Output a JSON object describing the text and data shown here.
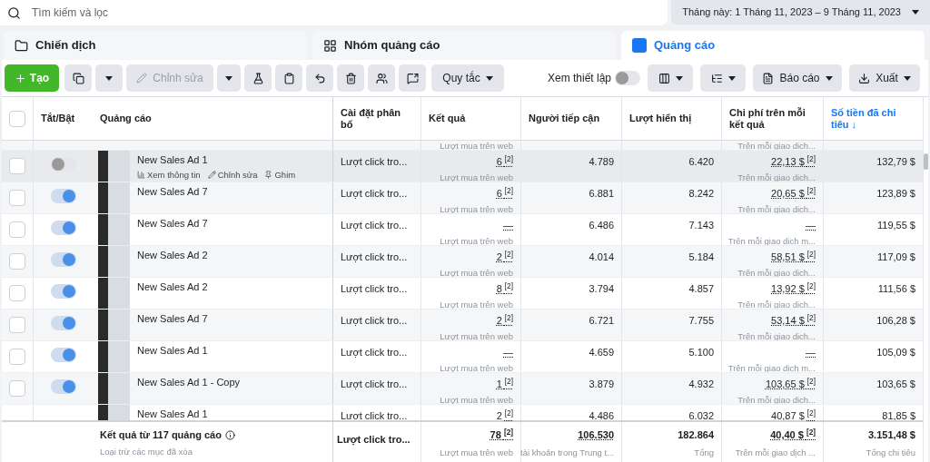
{
  "search": {
    "placeholder": "Tìm kiếm và lọc"
  },
  "date_range": "Tháng này: 1 Tháng 11, 2023 – 9 Tháng 11, 2023",
  "tabs": [
    {
      "label": "Chiến dịch",
      "selected": false,
      "kind": "folder"
    },
    {
      "label": "Nhóm quảng cáo",
      "selected": false,
      "kind": "grid"
    },
    {
      "label": "Quảng cáo",
      "selected": true,
      "kind": "ad"
    }
  ],
  "toolbar": {
    "create": "Tạo",
    "edit": {
      "label": "Chỉnh sửa",
      "disabled": true
    },
    "rules": "Quy tắc",
    "view_settings": {
      "label": "Xem thiết lập",
      "on": false
    },
    "report": "Báo cáo",
    "export": "Xuất"
  },
  "table": {
    "header_checkbox": {
      "checked": false
    },
    "columns": [
      {
        "label": "Tắt/Bật",
        "sorted": false
      },
      {
        "label": "Quảng cáo",
        "sorted": false
      },
      {
        "label": "Cài đặt phân bổ",
        "sorted": false
      },
      {
        "label": "Kết quả",
        "sorted": false
      },
      {
        "label": "Người tiếp cận",
        "sorted": false
      },
      {
        "label": "Lượt hiển thị",
        "sorted": false
      },
      {
        "label": "Chi phí trên mỗi kết quả",
        "sorted": false
      },
      {
        "label": "Số tiền đã chi tiêu ↓",
        "sorted": true
      }
    ],
    "rows": [
      {
        "kind": "cut_top",
        "result_sub": "Lượt mua trên web",
        "cost_sub": "Trên mỗi giao dịch..."
      },
      {
        "kind": "full",
        "checked": false,
        "on": false,
        "highlighted": true,
        "name": "New Sales Ad 1",
        "actions": [
          "Xem thông tin",
          "Chỉnh sửa",
          "Ghim"
        ],
        "attribution": "Lượt click tro...",
        "result": "6 $^{[2]}$",
        "result_sub": "Lượt mua trên web",
        "reach": "4.789",
        "impressions": "6.420",
        "cost": "22,13 $ $^{[2]}$",
        "cost_sub": "Trên mỗi giao dịch...",
        "spent": "132,79 $"
      },
      {
        "kind": "full",
        "checked": false,
        "on": true,
        "highlighted": false,
        "name": "New Sales Ad 7",
        "attribution": "Lượt click tro...",
        "result": "6 $^{[2]}$",
        "result_sub": "Lượt mua trên web",
        "reach": "6.881",
        "impressions": "8.242",
        "cost": "20,65 $ $^{[2]}$",
        "cost_sub": "Trên mỗi giao dịch...",
        "spent": "123,89 $"
      },
      {
        "kind": "full",
        "checked": false,
        "on": true,
        "highlighted": false,
        "name": "New Sales Ad 7",
        "attribution": "Lượt click tro...",
        "result": "—",
        "result_sub": "Lượt mua trên web",
        "reach": "6.486",
        "impressions": "7.143",
        "cost": "—",
        "cost_sub": "Trên mỗi giao dịch m...",
        "spent": "119,55 $"
      },
      {
        "kind": "full",
        "checked": false,
        "on": true,
        "highlighted": false,
        "name": "New Sales Ad 2",
        "attribution": "Lượt click tro...",
        "result": "2 $^{[2]}$",
        "result_sub": "Lượt mua trên web",
        "reach": "4.014",
        "impressions": "5.184",
        "cost": "58,51 $ $^{[2]}$",
        "cost_sub": "Trên mỗi giao dịch...",
        "spent": "117,09 $"
      },
      {
        "kind": "full",
        "checked": false,
        "on": true,
        "highlighted": false,
        "name": "New Sales Ad 2",
        "attribution": "Lượt click tro...",
        "result": "8 $^{[2]}$",
        "result_sub": "Lượt mua trên web",
        "reach": "3.794",
        "impressions": "4.857",
        "cost": "13,92 $ $^{[2]}$",
        "cost_sub": "Trên mỗi giao dịch...",
        "spent": "111,56 $"
      },
      {
        "kind": "full",
        "checked": false,
        "on": true,
        "highlighted": false,
        "name": "New Sales Ad 7",
        "attribution": "Lượt click tro...",
        "result": "2 $^{[2]}$",
        "result_sub": "Lượt mua trên web",
        "reach": "6.721",
        "impressions": "7.755",
        "cost": "53,14 $ $^{[2]}$",
        "cost_sub": "Trên mỗi giao dịch...",
        "spent": "106,28 $"
      },
      {
        "kind": "full",
        "checked": false,
        "on": true,
        "highlighted": false,
        "name": "New Sales Ad 1",
        "attribution": "Lượt click tro...",
        "result": "—",
        "result_sub": "Lượt mua trên web",
        "reach": "4.659",
        "impressions": "5.100",
        "cost": "—",
        "cost_sub": "Trên mỗi giao dịch m...",
        "spent": "105,09 $"
      },
      {
        "kind": "full",
        "checked": false,
        "on": true,
        "highlighted": false,
        "name": "New Sales Ad 1 - Copy",
        "attribution": "Lượt click tro...",
        "result": "1 $^{[2]}$",
        "result_sub": "Lượt mua trên web",
        "reach": "3.879",
        "impressions": "4.932",
        "cost": "103,65 $ $^{[2]}$",
        "cost_sub": "Trên mỗi giao dịch...",
        "spent": "103,65 $"
      },
      {
        "kind": "cut_bottom",
        "name": "New Sales Ad 1",
        "attribution": "Lượt click tro...",
        "result": "2 $^{[2]}$",
        "reach": "4.486",
        "impressions": "6.032",
        "cost": "40,87 $ $^{[2]}$",
        "spent": "81,85 $"
      }
    ],
    "footer": {
      "title": "Kết quả từ 117 quảng cáo",
      "note": "Loại trừ các mục đã xóa",
      "attribution": "Lượt click tro...",
      "result": "78 $^{[2]}$",
      "result_sub": "Lượt mua trên web",
      "reach": "106.530",
      "reach_sub": "tài khoản trong Trung t...",
      "impressions": "182.864",
      "impressions_sub": "Tổng",
      "cost": "40,40 $ $^{[2]}$",
      "cost_sub": "Trên mỗi giao dịch ...",
      "spent": "3.151,48 $",
      "spent_sub": "Tổng chi tiêu"
    }
  }
}
